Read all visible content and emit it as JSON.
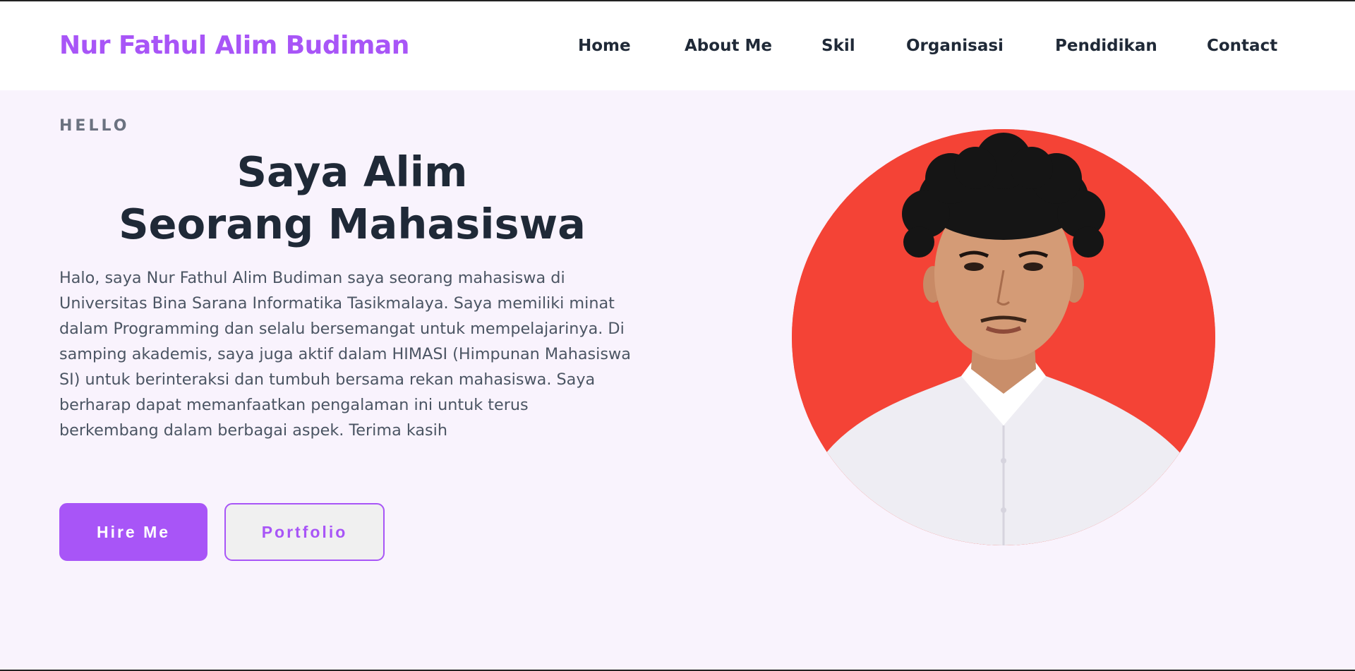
{
  "header": {
    "brand": "Nur Fathul Alim Budiman",
    "nav": [
      "Home",
      "About Me",
      "Skil",
      "Organisasi",
      "Pendidikan",
      "Contact"
    ]
  },
  "hero": {
    "greeting": "HELLO",
    "title_prefix": "Saya ",
    "title_name": "Alim",
    "title_line2": "Seorang Mahasiswa",
    "intro": "Halo, saya Nur Fathul Alim Budiman saya seorang mahasiswa di Universitas Bina Sarana Informatika Tasikmalaya. Saya memiliki minat dalam Programming dan selalu bersemangat untuk mempelajarinya. Di samping akademis, saya juga aktif dalam HIMASI (Himpunan Mahasiswa SI) untuk berinteraksi dan tumbuh bersama rekan mahasiswa. Saya berharap dapat memanfaatkan pengalaman ini untuk terus berkembang dalam berbagai aspek. Terima kasih",
    "hire_label": "Hire Me",
    "portfolio_label": "Portfolio"
  },
  "colors": {
    "accent": "#a855f7",
    "hero_bg": "#f9f3fd",
    "photo_bg": "#f44336",
    "text_dark": "#1f2937",
    "text_muted": "#4b5563"
  }
}
